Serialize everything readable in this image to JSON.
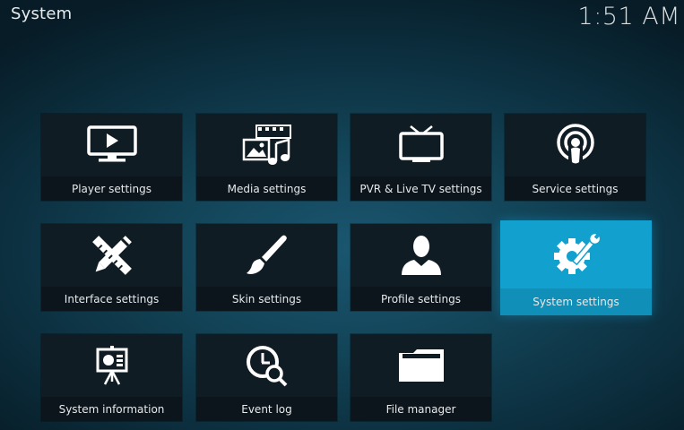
{
  "header": {
    "title": "System",
    "clock": "1:51 AM"
  },
  "tiles": [
    {
      "label": "Player settings",
      "icon": "player-icon"
    },
    {
      "label": "Media settings",
      "icon": "media-icon"
    },
    {
      "label": "PVR & Live TV settings",
      "icon": "tv-icon"
    },
    {
      "label": "Service settings",
      "icon": "service-icon"
    },
    {
      "label": "Interface settings",
      "icon": "interface-icon"
    },
    {
      "label": "Skin settings",
      "icon": "paintbrush-icon"
    },
    {
      "label": "Profile settings",
      "icon": "profile-icon"
    },
    {
      "label": "System settings",
      "icon": "gear-wrench-icon",
      "focused": true
    },
    {
      "label": "System information",
      "icon": "presentation-board-icon"
    },
    {
      "label": "Event log",
      "icon": "clock-search-icon"
    },
    {
      "label": "File manager",
      "icon": "folder-icon"
    }
  ],
  "colors": {
    "focus": "#12a0cf",
    "tile": "#101c24",
    "background": "#134559"
  }
}
